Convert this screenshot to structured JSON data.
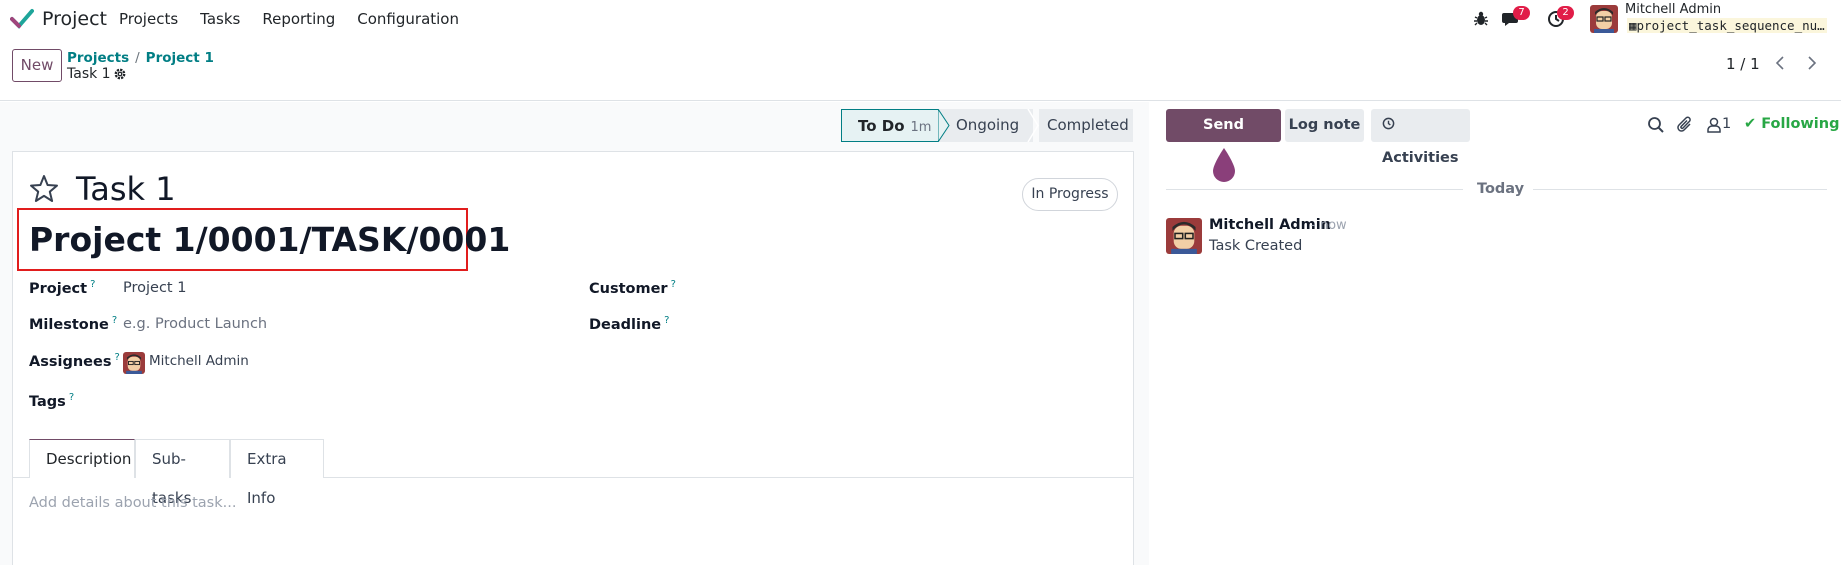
{
  "navbar": {
    "app_name": "Project",
    "menu": [
      "Projects",
      "Tasks",
      "Reporting",
      "Configuration"
    ],
    "messages_badge": "7",
    "activities_badge": "2",
    "user_name": "Mitchell Admin",
    "db_name": "project_task_sequence_nu…"
  },
  "control_panel": {
    "new_label": "New",
    "breadcrumb": [
      "Projects",
      "Project 1"
    ],
    "current": "Task 1",
    "pager": "1 / 1"
  },
  "statusbar": {
    "stages": [
      {
        "label": "To Do",
        "duration": "1m",
        "active": true
      },
      {
        "label": "Ongoing",
        "active": false
      },
      {
        "label": "Completed",
        "active": false
      }
    ]
  },
  "form": {
    "title": "Task 1",
    "state": "In Progress",
    "sequence": "Project 1/0001/TASK/0001",
    "fields": {
      "project_label": "Project",
      "project_value": "Project 1",
      "milestone_label": "Milestone",
      "milestone_placeholder": "e.g. Product Launch",
      "assignees_label": "Assignees",
      "assignees_value": "Mitchell Admin",
      "tags_label": "Tags",
      "customer_label": "Customer",
      "deadline_label": "Deadline",
      "help_mark": "?"
    },
    "tabs": [
      "Description",
      "Sub-tasks",
      "Extra Info"
    ],
    "description_placeholder": "Add details about this task..."
  },
  "chatter": {
    "send_message": "Send message",
    "log_note": "Log note",
    "activities": "Activities",
    "followers": "1",
    "following": "Following",
    "date_separator": "Today",
    "message": {
      "author": "Mitchell Admin",
      "time": "- now",
      "body": "Task Created"
    }
  },
  "colors": {
    "primary": "#714b67",
    "accent": "#017e84",
    "badge": "#e11d48",
    "success": "#28a745",
    "highlight_box": "#e11d1d"
  }
}
